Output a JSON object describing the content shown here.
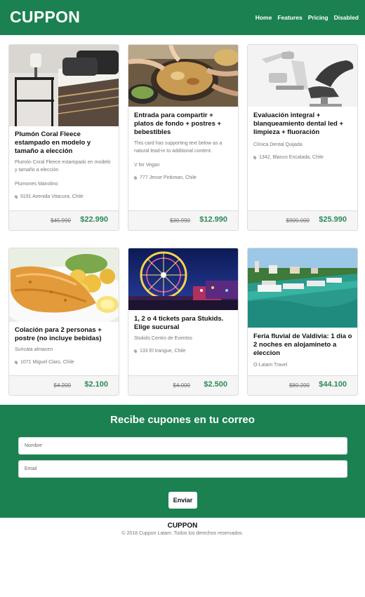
{
  "header": {
    "brand": "CUPPON",
    "nav": [
      "Home",
      "Features",
      "Pricing",
      "Disabled"
    ]
  },
  "cards": [
    {
      "title": "Plumón Coral Fleece estampado en modelo y tamaño a elección",
      "description": "Plumón Coral Fleece estampado en modelo y tamaño a elección",
      "vendor": "Plumones Manolino",
      "address": "9191 Avenida Vitacura, Chile",
      "old_price": "$45.990",
      "new_price": "$22.990"
    },
    {
      "title": "Entrada para compartir + platos de fondo + postres + bebestibles",
      "description": "This card has supporting text below as a natural lead-in to additional content.",
      "vendor": "V for Vegan",
      "address": "777 Jesse Pinkman, Chile",
      "old_price": "$30.990",
      "new_price": "$12.990"
    },
    {
      "title": "Evaluación integral + blanqueamiento dental led + limpieza + fluoración",
      "description": "",
      "vendor": "Clínica Dental Quijada",
      "address": "1342, Blanco Encalada, Chile",
      "old_price": "$900.000",
      "new_price": "$25.990"
    },
    {
      "title": "Colación para 2 personas + postre (no incluye bebidas)",
      "description": "",
      "vendor": "Suricata almacen",
      "address": "1071 Miguel Claro, Chile",
      "old_price": "$4.200",
      "new_price": "$2.100"
    },
    {
      "title": "1, 2 o 4 tickets para Stukids. Elige sucursal",
      "description": "",
      "vendor": "Stukids Centro de Eventos",
      "address": "133 El trangue, Chile",
      "old_price": "$4.000",
      "new_price": "$2.500"
    },
    {
      "title": "Feria fluvial de Valdivia: 1 dia o 2 noches en alojamineto a eleccion",
      "description": "",
      "vendor": "O-Latam Travel",
      "address": "",
      "old_price": "$80.200",
      "new_price": "$44.100"
    }
  ],
  "newsletter": {
    "title": "Recibe cupones en tu correo",
    "name_placeholder": "Nombre",
    "email_placeholder": "Email",
    "button": "Enviar"
  },
  "footer": {
    "brand": "CUPPON",
    "copyright": "© 2018 Cuppon Latam .Todos los derechos reservados."
  },
  "colors": {
    "brand_green": "#1b8150",
    "price_green": "#2d8a57"
  }
}
